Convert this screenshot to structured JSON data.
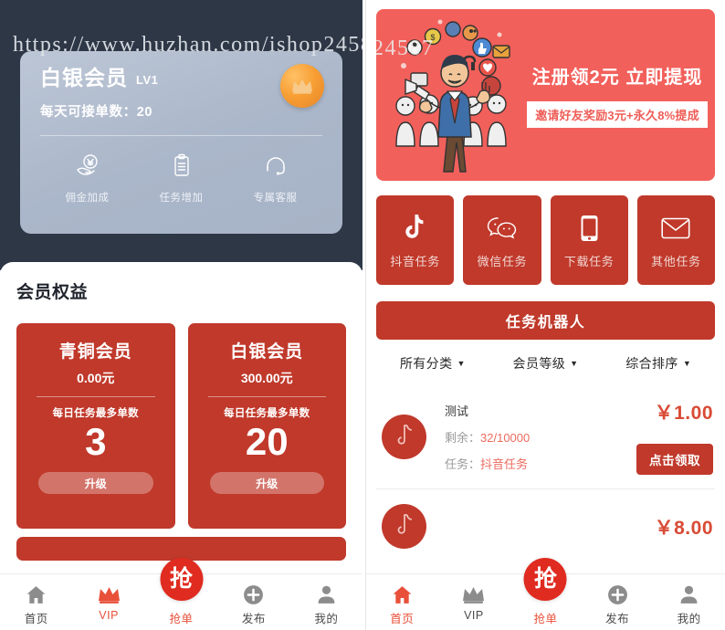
{
  "watermark": {
    "left": "https://www.huzhan.com/ishop24587",
    "right_fragment": "24587"
  },
  "left_screen": {
    "vip_card": {
      "name": "白银会员",
      "level": "LV1",
      "daily_orders": "每天可接单数：20",
      "crown_icon": "crown-icon",
      "perks": [
        {
          "icon": "commission-hand-yen-icon",
          "label": "佣金加成"
        },
        {
          "icon": "clipboard-task-icon",
          "label": "任务增加"
        },
        {
          "icon": "headset-support-icon",
          "label": "专属客服"
        }
      ]
    },
    "rights": {
      "title": "会员权益",
      "tiers": [
        {
          "name": "青铜会员",
          "price": "0.00元",
          "cap_label": "每日任务最多单数",
          "cap_value": "3",
          "button": "升级"
        },
        {
          "name": "白银会员",
          "price": "300.00元",
          "cap_label": "每日任务最多单数",
          "cap_value": "20",
          "button": "升级"
        }
      ]
    },
    "tabbar": [
      {
        "icon": "home-icon",
        "label": "首页",
        "active": false
      },
      {
        "icon": "crown-icon",
        "label": "VIP",
        "active": true
      },
      {
        "icon": "grab-order-icon",
        "label": "抢单",
        "active": true,
        "center": true,
        "glyph": "抢"
      },
      {
        "icon": "plus-circle-icon",
        "label": "发布",
        "active": false
      },
      {
        "icon": "person-icon",
        "label": "我的",
        "active": false
      }
    ]
  },
  "right_screen": {
    "banner": {
      "headline": "注册领2元 立即提现",
      "chip": "邀请好友奖励3元+永久8%提成",
      "illustration": "megaphone-man-referral-illustration",
      "bg_color": "#f2605b"
    },
    "categories": [
      {
        "icon": "tiktok-icon",
        "label": "抖音任务"
      },
      {
        "icon": "wechat-icon",
        "label": "微信任务"
      },
      {
        "icon": "phone-download-icon",
        "label": "下载任务"
      },
      {
        "icon": "envelope-icon",
        "label": "其他任务"
      }
    ],
    "robot_button": "任务机器人",
    "filters": [
      {
        "label": "所有分类",
        "caret": "▼"
      },
      {
        "label": "会员等级",
        "caret": "▼"
      },
      {
        "label": "综合排序",
        "caret": "▼"
      }
    ],
    "tasks": [
      {
        "avatar_icon": "tiktok-icon",
        "title": "测试",
        "remaining_label": "剩余：",
        "remaining_value": "32/10000",
        "type_label": "任务：",
        "type_value": "抖音任务",
        "price": "￥1.00",
        "button": "点击领取"
      },
      {
        "avatar_icon": "tiktok-icon",
        "title": "",
        "remaining_label": "",
        "remaining_value": "",
        "type_label": "",
        "type_value": "",
        "price": "￥8.00",
        "button": ""
      }
    ],
    "tabbar": [
      {
        "icon": "home-icon",
        "label": "首页",
        "active": true
      },
      {
        "icon": "crown-icon",
        "label": "VIP",
        "active": false
      },
      {
        "icon": "grab-order-icon",
        "label": "抢单",
        "active": true,
        "center": true,
        "glyph": "抢"
      },
      {
        "icon": "plus-circle-icon",
        "label": "发布",
        "active": false
      },
      {
        "icon": "person-icon",
        "label": "我的",
        "active": false
      }
    ]
  },
  "colors": {
    "brand_red": "#c0392b",
    "banner_red": "#f2605b",
    "dark_header": "#2e3746",
    "card_silver": "#aab6c9",
    "accent_orange": "#f79e33",
    "price_red": "#d94a35"
  }
}
